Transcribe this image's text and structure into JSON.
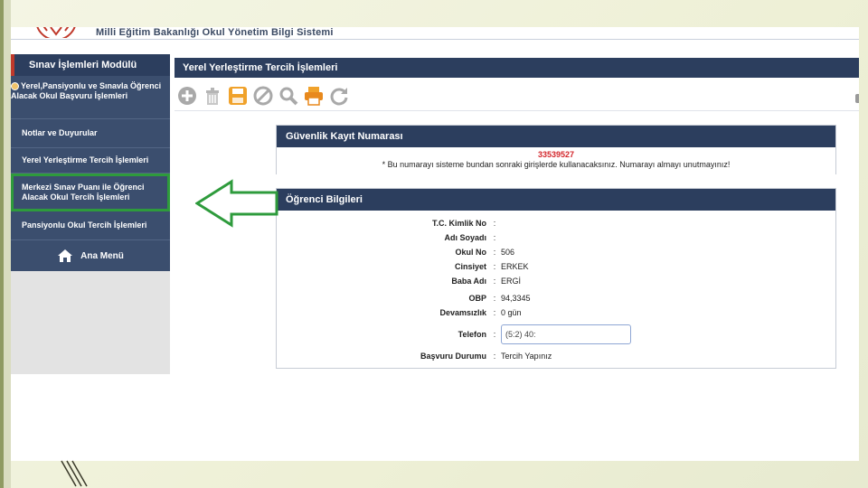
{
  "app": {
    "title": "Milli Eğitim Bakanlığı Okul Yönetim Bilgi Sistemi"
  },
  "sidebar": {
    "title": "Sınav İşlemleri Modülü",
    "parent_item": "Yerel,Pansiyonlu ve Sınavla Öğrenci Alacak Okul Başvuru İşlemleri",
    "items": [
      {
        "label": "Notlar ve Duyurular"
      },
      {
        "label": "Yerel Yerleştirme Tercih İşlemleri"
      },
      {
        "label": "Merkezi Sınav Puanı ile Öğrenci Alacak Okul Tercih İşlemleri"
      },
      {
        "label": "Pansiyonlu Okul Tercih İşlemleri"
      }
    ],
    "home_label": "Ana Menü"
  },
  "main": {
    "header": "Yerel Yerleştirme Tercih İşlemleri",
    "toolbar": [
      "add-icon",
      "delete-icon",
      "save-icon",
      "cancel-icon",
      "search-icon",
      "print-icon",
      "refresh-icon"
    ],
    "security": {
      "title": "Güvenlik Kayıt Numarası",
      "number": "33539527",
      "note": "* Bu numarayı sisteme bundan sonraki girişlerde kullanacaksınız. Numarayı almayı unutmayınız!"
    },
    "student": {
      "title": "Öğrenci Bilgileri",
      "rows": [
        {
          "label": "T.C. Kimlik No",
          "value": ""
        },
        {
          "label": "Adı Soyadı",
          "value": ""
        },
        {
          "label": "Okul No",
          "value": "506"
        },
        {
          "label": "Cinsiyet",
          "value": "ERKEK"
        },
        {
          "label": "Baba Adı",
          "value": "ERGİ"
        },
        {
          "label": "OBP",
          "value": "94,3345"
        },
        {
          "label": "Devamsızlık",
          "value": "0 gün"
        }
      ],
      "phone_label": "Telefon",
      "phone_value": "(5:2) 40:",
      "status_label": "Başvuru Durumu",
      "status_value": "Tercih Yapınız"
    }
  },
  "colors": {
    "nav_dark": "#2c3e5e",
    "nav": "#3b4e6e",
    "highlight": "#2e9b3c",
    "security_number": "#d3262b"
  }
}
